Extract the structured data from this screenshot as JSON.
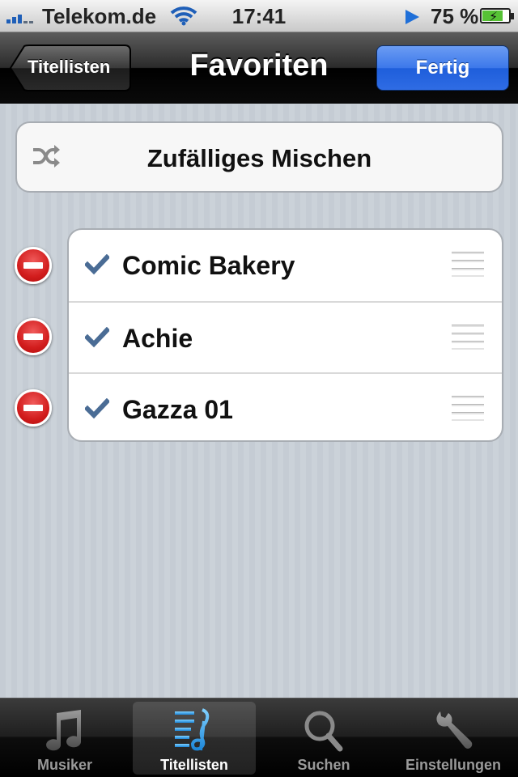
{
  "status_bar": {
    "carrier": "Telekom.de",
    "time": "17:41",
    "battery_percent": "75 %",
    "icons": [
      "signal-icon",
      "wifi-icon",
      "play-icon",
      "battery-charging-icon"
    ]
  },
  "nav": {
    "back_label": "Titellisten",
    "title": "Favoriten",
    "done_label": "Fertig"
  },
  "shuffle": {
    "label": "Zufälliges Mischen",
    "icon": "shuffle-icon"
  },
  "playlist": [
    {
      "title": "Comic Bakery"
    },
    {
      "title": "Achie"
    },
    {
      "title": "Gazza 01"
    }
  ],
  "tabs": [
    {
      "label": "Musiker",
      "icon": "music-note-icon",
      "active": false
    },
    {
      "label": "Titellisten",
      "icon": "playlist-icon",
      "active": true
    },
    {
      "label": "Suchen",
      "icon": "search-icon",
      "active": false
    },
    {
      "label": "Einstellungen",
      "icon": "wrench-icon",
      "active": false
    }
  ],
  "colors": {
    "accent_blue": "#2f6ce4",
    "delete_red": "#d21d1d",
    "background": "#c5ccd4"
  }
}
